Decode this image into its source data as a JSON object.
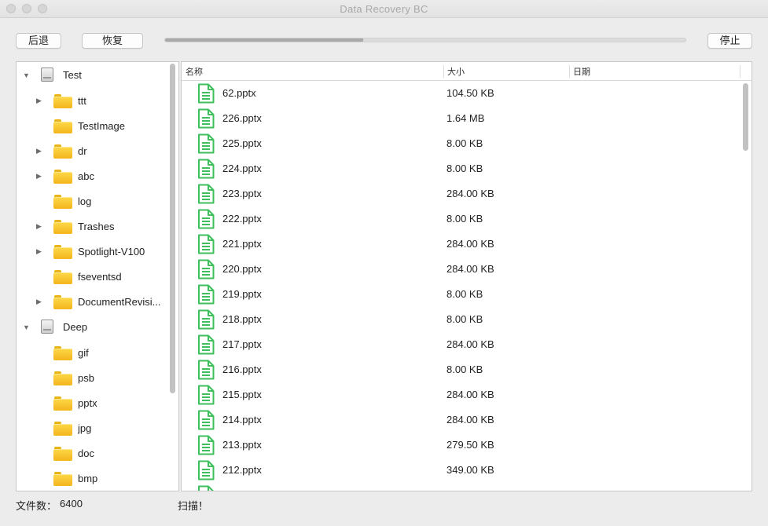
{
  "window": {
    "title": "Data Recovery BC"
  },
  "toolbar": {
    "back_label": "后退",
    "recover_label": "恢复",
    "stop_label": "停止",
    "progress_fraction": 0.38
  },
  "tree": {
    "items": [
      {
        "label": "Test",
        "type": "disk",
        "expanded": true,
        "level": 0
      },
      {
        "label": "ttt",
        "type": "folder",
        "has_children": true,
        "level": 1
      },
      {
        "label": "TestImage",
        "type": "folder",
        "has_children": false,
        "level": 1
      },
      {
        "label": "dr",
        "type": "folder",
        "has_children": true,
        "level": 1
      },
      {
        "label": "abc",
        "type": "folder",
        "has_children": true,
        "level": 1
      },
      {
        "label": "log",
        "type": "folder",
        "has_children": false,
        "level": 1
      },
      {
        "label": "Trashes",
        "type": "folder",
        "has_children": true,
        "level": 1
      },
      {
        "label": "Spotlight-V100",
        "type": "folder",
        "has_children": true,
        "level": 1
      },
      {
        "label": "fseventsd",
        "type": "folder",
        "has_children": false,
        "level": 1
      },
      {
        "label": "DocumentRevisi...",
        "type": "folder",
        "has_children": true,
        "level": 1
      },
      {
        "label": "Deep",
        "type": "disk",
        "expanded": true,
        "level": 0
      },
      {
        "label": "gif",
        "type": "folder",
        "has_children": false,
        "level": 1
      },
      {
        "label": "psb",
        "type": "folder",
        "has_children": false,
        "level": 1
      },
      {
        "label": "pptx",
        "type": "folder",
        "has_children": false,
        "level": 1
      },
      {
        "label": "jpg",
        "type": "folder",
        "has_children": false,
        "level": 1
      },
      {
        "label": "doc",
        "type": "folder",
        "has_children": false,
        "level": 1
      },
      {
        "label": "bmp",
        "type": "folder",
        "has_children": false,
        "level": 1
      }
    ]
  },
  "file_list": {
    "columns": [
      "名称",
      "大小",
      "日期"
    ],
    "rows": [
      {
        "name": "62.pptx",
        "size": "104.50 KB",
        "date": ""
      },
      {
        "name": "226.pptx",
        "size": "1.64 MB",
        "date": ""
      },
      {
        "name": "225.pptx",
        "size": "8.00 KB",
        "date": ""
      },
      {
        "name": "224.pptx",
        "size": "8.00 KB",
        "date": ""
      },
      {
        "name": "223.pptx",
        "size": "284.00 KB",
        "date": ""
      },
      {
        "name": "222.pptx",
        "size": "8.00 KB",
        "date": ""
      },
      {
        "name": "221.pptx",
        "size": "284.00 KB",
        "date": ""
      },
      {
        "name": "220.pptx",
        "size": "284.00 KB",
        "date": ""
      },
      {
        "name": "219.pptx",
        "size": "8.00 KB",
        "date": ""
      },
      {
        "name": "218.pptx",
        "size": "8.00 KB",
        "date": ""
      },
      {
        "name": "217.pptx",
        "size": "284.00 KB",
        "date": ""
      },
      {
        "name": "216.pptx",
        "size": "8.00 KB",
        "date": ""
      },
      {
        "name": "215.pptx",
        "size": "284.00 KB",
        "date": ""
      },
      {
        "name": "214.pptx",
        "size": "284.00 KB",
        "date": ""
      },
      {
        "name": "213.pptx",
        "size": "279.50 KB",
        "date": ""
      },
      {
        "name": "212.pptx",
        "size": "349.00 KB",
        "date": ""
      }
    ]
  },
  "status": {
    "file_count_label": "文件数：",
    "file_count_value": "6400",
    "message": "扫描！"
  },
  "colors": {
    "doc_icon": "#3dbf5b",
    "folder": "#f4b51c"
  }
}
